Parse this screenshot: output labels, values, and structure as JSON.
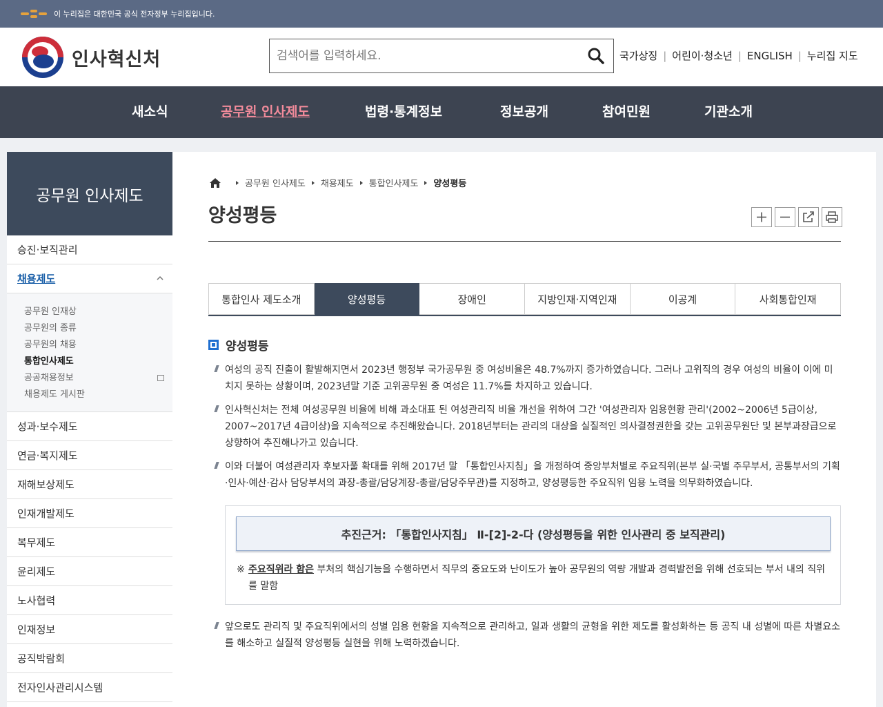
{
  "banner": {
    "text": "이 누리집은 대한민국 공식 전자정부 누리집입니다."
  },
  "header": {
    "logo_name": "인사혁신처",
    "search_placeholder": "검색어를 입력하세요.",
    "util_links": [
      "국가상징",
      "어린이·청소년",
      "ENGLISH",
      "누리집 지도"
    ]
  },
  "gnb": [
    "새소식",
    "공무원 인사제도",
    "법령·통계정보",
    "정보공개",
    "참여민원",
    "기관소개"
  ],
  "lnb": {
    "title": "공무원 인사제도",
    "items_top": [
      "승진·보직관리"
    ],
    "active_item": "채용제도",
    "sub_items": [
      "공무원 인재상",
      "공무원의 종류",
      "공무원의 채용",
      "통합인사제도",
      "공공채용정보",
      "채용제도 게시판"
    ],
    "items_bottom": [
      "성과·보수제도",
      "연금·복지제도",
      "재해보상제도",
      "인재개발제도",
      "복무제도",
      "윤리제도",
      "노사협력",
      "인재정보",
      "공직박람회",
      "전자인사관리시스템"
    ]
  },
  "breadcrumb": [
    "공무원 인사제도",
    "채용제도",
    "통합인사제도",
    "양성평등"
  ],
  "page_title": "양성평등",
  "tabs": [
    "통합인사 제도소개",
    "양성평등",
    "장애인",
    "지방인재·지역인재",
    "이공계",
    "사회통합인재"
  ],
  "section_title": "양성평등",
  "paragraphs": [
    "여성의 공직 진출이 활발해지면서 2023년 행정부 국가공무원 중 여성비율은 48.7%까지 증가하였습니다. 그러나 고위직의 경우 여성의 비율이 이에 미치지 못하는 상황이며, 2023년말 기준 고위공무원 중 여성은 11.7%를 차지하고 있습니다.",
    "인사혁신처는 전체 여성공무원 비율에 비해 과소대표 된 여성관리직 비율 개선을 위하여 그간 '여성관리자 임용현황 관리'(2002~2006년 5급이상, 2007~2017년 4급이상)을 지속적으로 추진해왔습니다. 2018년부터는 관리의 대상을 실질적인 의사결정권한을 갖는 고위공무원단 및 본부과장급으로 상향하여 추진해나가고 있습니다.",
    "이와 더불어 여성관리자 후보자풀 확대를 위해 2017년 말 「통합인사지침」을 개정하여 중앙부처별로 주요직위(본부 실·국별 주무부서, 공통부서의 기획·인사·예산·감사 담당부서의 과장-총괄/담당계장-총괄/담당주무관)를 지정하고, 양성평등한 주요직위 임용 노력을 의무화하였습니다."
  ],
  "basis": {
    "title": "추진근거: 「통합인사지침」 Ⅱ-[2]-2-다 (양성평등을 위한 인사관리 중 보직관리)",
    "note_mark": "※",
    "note_term": "주요직위라 함은",
    "note_text": " 부처의 핵심기능을 수행하면서 직무의 중요도와 난이도가 높아 공무원의 역량 개발과 경력발전을 위해 선호되는 부서 내의 직위를 말함"
  },
  "closing": "앞으로도 관리직 및 주요직위에서의 성별 임용 현황을 지속적으로 관리하고, 일과 생활의 균형을 위한 제도를 활성화하는 등 공직 내 성별에 따른 차별요소를 해소하고 실질적 양성평등 실현을 위해 노력하겠습니다.",
  "colors": {
    "gnb_bg": "#3d4451",
    "gnb_active": "#f28b9b",
    "lnb_title_bg": "#3d4a5c",
    "accent_blue": "#1f6fd0"
  }
}
